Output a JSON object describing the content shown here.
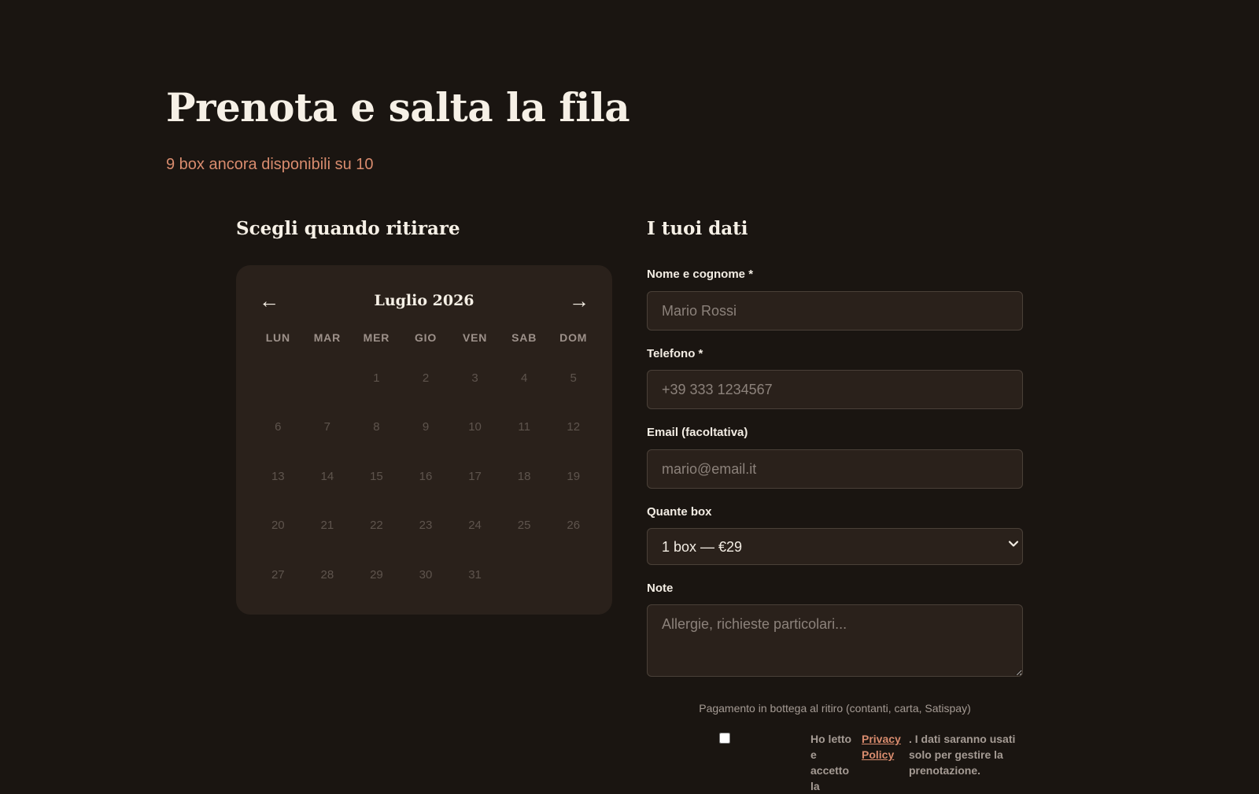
{
  "header": {
    "title": "Prenota e salta la fila",
    "availability": "9 box ancora disponibili su 10"
  },
  "calendar": {
    "section_title": "Scegli quando ritirare",
    "prev_icon": "arrow-left-icon",
    "next_icon": "arrow-right-icon",
    "prev_glyph": "←",
    "next_glyph": "→",
    "month_label": "Luglio 2026",
    "weekdays": [
      "LUN",
      "MAR",
      "MER",
      "GIO",
      "VEN",
      "SAB",
      "DOM"
    ],
    "leading_blanks": 2,
    "days": [
      "1",
      "2",
      "3",
      "4",
      "5",
      "6",
      "7",
      "8",
      "9",
      "10",
      "11",
      "12",
      "13",
      "14",
      "15",
      "16",
      "17",
      "18",
      "19",
      "20",
      "21",
      "22",
      "23",
      "24",
      "25",
      "26",
      "27",
      "28",
      "29",
      "30",
      "31"
    ]
  },
  "form": {
    "section_title": "I tuoi dati",
    "name": {
      "label": "Nome e cognome *",
      "placeholder": "Mario Rossi",
      "value": ""
    },
    "phone": {
      "label": "Telefono *",
      "placeholder": "+39 333 1234567",
      "value": ""
    },
    "email": {
      "label": "Email (facoltativa)",
      "placeholder": "mario@email.it",
      "value": ""
    },
    "quantity": {
      "label": "Quante box",
      "selected": "1 box — €29",
      "chevron_icon": "chevron-down-icon"
    },
    "notes": {
      "label": "Note",
      "placeholder": "Allergie, richieste particolari...",
      "value": ""
    },
    "payment_note": "Pagamento in bottega al ritiro (contanti, carta, Satispay)",
    "consent": {
      "prefix": "Ho letto e accetto la",
      "link": "Privacy Policy",
      "suffix": ". I dati saranno usati solo per gestire la prenotazione."
    }
  },
  "colors": {
    "background": "#1a1511",
    "card": "#2a211b",
    "accent": "#d98c6e",
    "text": "#f3ede4",
    "muted_day": "#5e544d"
  }
}
